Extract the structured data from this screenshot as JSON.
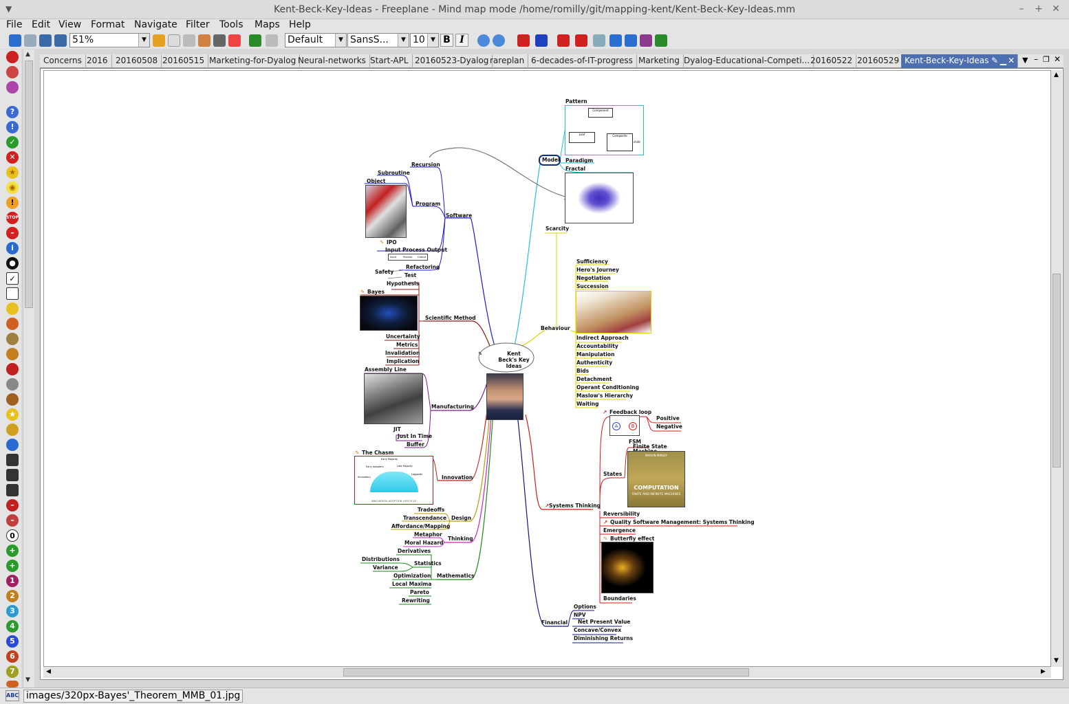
{
  "window": {
    "title": "Kent-Beck-Key-Ideas - Freeplane - Mind map mode /home/romilly/git/mapping-kent/Kent-Beck-Key-Ideas.mm",
    "controls": [
      "–",
      "+",
      "✕"
    ]
  },
  "menubar": [
    "File",
    "Edit",
    "View",
    "Format",
    "Navigate",
    "Filter",
    "Tools",
    "Maps",
    "Help"
  ],
  "toolbar": {
    "zoom": "51%",
    "style": "Default",
    "font": "SansS...",
    "size": "10",
    "bold": "B",
    "italic": "I"
  },
  "tabs": [
    "Concerns",
    "2016",
    "20160508",
    "20160515",
    "Marketing-for-Dyalog",
    "Neural-networks",
    "Start-APL",
    "20160523-Dyalog",
    "rareplan",
    "6-decades-of-IT-progress",
    "Marketing",
    "Dyalog-Educational-Competi...",
    "20160522",
    "20160529",
    "Kent-Beck-Key-Ideas"
  ],
  "status": {
    "path": "images/320px-Bayes'_Theorem_MMB_01.jpg",
    "abc": "ABC"
  },
  "colors": {
    "software": "#1a1ad0",
    "scientific": "#8b1a1a",
    "manufacturing": "#7a1a8a",
    "innovation": "#c01818",
    "design": "#b89a00",
    "thinking": "#d020c0",
    "mathematics": "#1a8a1a",
    "financial": "#10108a",
    "systems": "#d01818",
    "behaviour": "#e0d000",
    "model": "#20c0d8",
    "active_tab": "#4d6fb0"
  },
  "map": {
    "root": "Kent Beck's Key Ideas",
    "nodes": {
      "pattern": "Pattern",
      "model": "Model",
      "paradigm": "Paradigm",
      "fractal": "Fractal",
      "scarcity": "Scarcity",
      "sufficiency": "Sufficiency",
      "heros": "Hero's Journey",
      "negotiation": "Negotiation",
      "succession": "Succession",
      "behaviour": "Behaviour",
      "indirect": "Indirect Approach",
      "accountability": "Accountability",
      "manipulation": "Manipulation",
      "authenticity": "Authenticity",
      "bids": "Bids",
      "detachment": "Detachment",
      "operant": "Operant Conditioning",
      "maslow": "Maslow's Hierarchy",
      "waiting": "Waiting",
      "feedback": "Feedback loop",
      "positive": "Positive",
      "negative": "Negative",
      "fsm": "FSM",
      "finite_state": "Finite State",
      "machine": "Machine",
      "states": "States",
      "systems": "Systems Thinking",
      "reversibility": "Reversibility",
      "quality": "Quality Software Management: Systems Thinking",
      "emergence": "Emergence",
      "butterfly": "Butterfly effect",
      "boundaries": "Boundaries",
      "financial": "Financial",
      "options": "Options",
      "npv": "NPV",
      "npv_full": "Net Present Value",
      "concave": "Concave/Convex",
      "diminishing": "Diminishing Returns",
      "recursion": "Recursion",
      "subroutine": "Subroutine",
      "object": "Object",
      "program": "Program",
      "software": "Software",
      "ipo": "IPO",
      "ipo_full": "Input Process Output",
      "refactoring": "Refactoring",
      "safety": "Safety",
      "test": "Test",
      "hypothesis": "Hypothesis",
      "bayes": "Bayes",
      "scientific": "Scientific Method",
      "uncertainty": "Uncertainty",
      "metrics": "Metrics",
      "invalidation": "Invalidation",
      "implication": "Implication",
      "assembly": "Assembly Line",
      "manufacturing": "Manufacturing",
      "jit": "JIT",
      "jit_full": "Just In Time",
      "buffer": "Buffer",
      "chasm": "The Chasm",
      "innovation": "Innovation",
      "tradeoffs": "Tradeoffs",
      "transcendance": "Transcendance",
      "design": "Design",
      "affordance": "Affordance/Mapping",
      "metaphor": "Metaphor",
      "thinking": "Thinking",
      "moral": "Moral Hazard",
      "derivatives": "Derivatives",
      "distributions": "Distributions",
      "statistics": "Statistics",
      "variance": "Variance",
      "optimization": "Optimization",
      "mathematics": "Mathematics",
      "local_maxima": "Local Maxima",
      "pareto": "Pareto",
      "rewriting": "Rewriting"
    },
    "image_labels": {
      "computation_title": "COMPUTATION",
      "computation_sub": "FINITE AND INFINITE MACHINES",
      "computation_author": "MARVIN MINSKY",
      "chasm_caption": "INNOVATION ADOPTION LIFECYCLE",
      "chasm_early": "Early Majority",
      "chasm_late": "Late Majority",
      "chasm_adopters": "Early Adopters",
      "chasm_innovators": "Innovators",
      "chasm_laggards": "Laggards",
      "feedback_a": "A",
      "feedback_b": "B",
      "ipo_in": "Input",
      "ipo_proc": "Process",
      "ipo_out": "Output",
      "pattern_component": "Component",
      "pattern_leaf": "Leaf",
      "pattern_composite": "Composite",
      "pattern_child": "child"
    }
  }
}
